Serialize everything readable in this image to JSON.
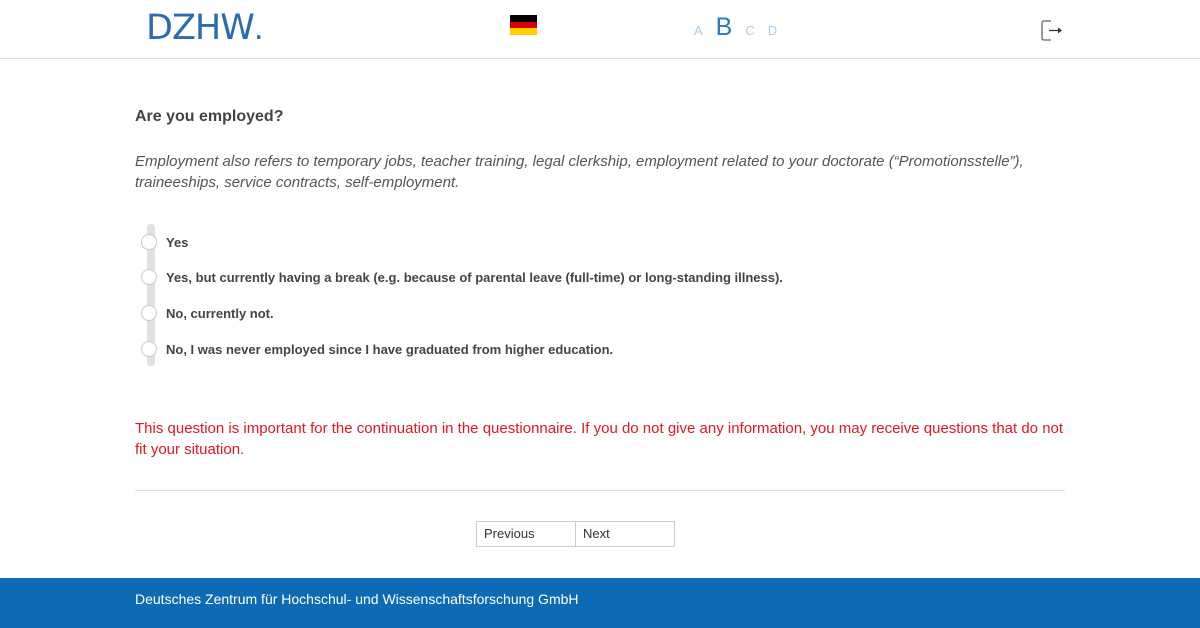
{
  "header": {
    "logo_text": "DZHW",
    "logo_dot": ".",
    "language_flag": "flag-germany-icon",
    "flag_colors": [
      "#000000",
      "#dd0000",
      "#ffce00"
    ],
    "sections": [
      {
        "label": "A",
        "active": false
      },
      {
        "label": "B",
        "active": true
      },
      {
        "label": "C",
        "active": false
      },
      {
        "label": "D",
        "active": false
      }
    ],
    "logout_icon": "logout-icon"
  },
  "main": {
    "question": "Are you employed?",
    "hint": "Employment also refers to temporary jobs, teacher training, legal clerkship, employment related to your doctorate (“Promotionsstelle”), traineeships, service contracts, self-employment.",
    "options": [
      {
        "label": "Yes",
        "selected": false
      },
      {
        "label": "Yes, but currently having a break (e.g. because of parental leave (full-time) or long-standing illness).",
        "selected": false
      },
      {
        "label": "No, currently not.",
        "selected": false
      },
      {
        "label": "No, I was never employed since I have graduated from higher education.",
        "selected": false
      }
    ],
    "warning": "This question is important for the continuation in the questionnaire. If you do not give any information, you may receive questions that do not fit your situation.",
    "previous_label": "Previous",
    "next_label": "Next"
  },
  "footer": {
    "text": "Deutsches Zentrum für Hochschul- und Wissenschaftsforschung GmbH"
  },
  "colors": {
    "brand_blue": "#2b6cb0",
    "footer_blue": "#0d6ab5",
    "warning_red": "#e0181f"
  }
}
